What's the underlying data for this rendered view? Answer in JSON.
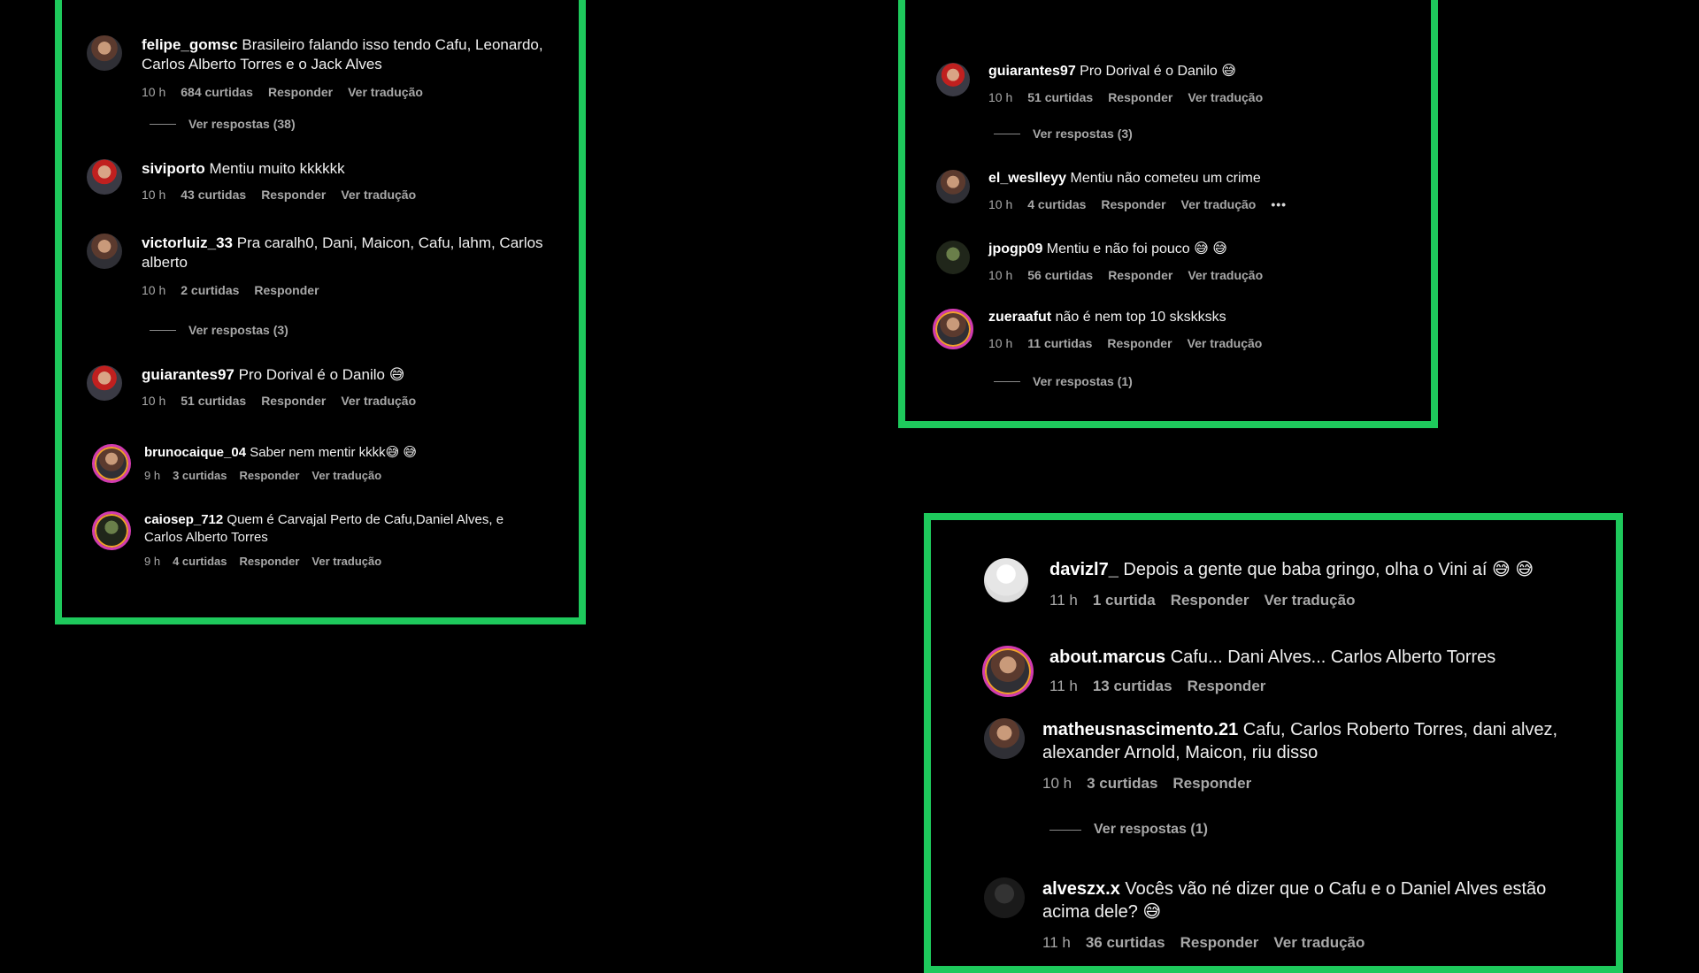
{
  "panel1": {
    "comments": [
      {
        "user": "felipe_gomsc",
        "text": "Brasileiro falando isso tendo Cafu, Leonardo,",
        "text2": "Carlos Alberto Torres e o Jack Alves",
        "time": "10 h",
        "likes": "684 curtidas",
        "reply": "Responder",
        "translate": "Ver tradução"
      },
      {
        "user": "siviporto",
        "text": "Mentiu muito kkkkkk",
        "time": "10 h",
        "likes": "43 curtidas",
        "reply": "Responder",
        "translate": "Ver tradução"
      },
      {
        "user": "victorluiz_33",
        "text": "Pra caralh0, Dani, Maicon, Cafu, lahm, Carlos",
        "text2": "alberto",
        "time": "10 h",
        "likes": "2 curtidas",
        "reply": "Responder"
      },
      {
        "user": "guiarantes97",
        "text": "Pro Dorival é o Danilo 😅",
        "time": "10 h",
        "likes": "51 curtidas",
        "reply": "Responder",
        "translate": "Ver tradução"
      },
      {
        "user": "brunocaique_04",
        "text": "Saber nem mentir kkkk😅 😅",
        "time": "9 h",
        "likes": "3 curtidas",
        "reply": "Responder",
        "translate": "Ver tradução"
      },
      {
        "user": "caiosep_712",
        "text": "Quem é Carvajal Perto de Cafu,Daniel Alves, e",
        "text2": "Carlos Alberto Torres",
        "time": "9 h",
        "likes": "4 curtidas",
        "reply": "Responder",
        "translate": "Ver tradução"
      }
    ],
    "replies": [
      "Ver respostas (38)",
      "Ver respostas (3)"
    ]
  },
  "panel2": {
    "comments": [
      {
        "user": "guiarantes97",
        "text": "Pro Dorival é o Danilo 😅",
        "time": "10 h",
        "likes": "51 curtidas",
        "reply": "Responder",
        "translate": "Ver tradução"
      },
      {
        "user": "el_weslleyy",
        "text": "Mentiu não cometeu um crime",
        "time": "10 h",
        "likes": "4 curtidas",
        "reply": "Responder",
        "translate": "Ver tradução",
        "more": "•••"
      },
      {
        "user": "jpogp09",
        "text": "Mentiu e não foi pouco 😅 😅",
        "time": "10 h",
        "likes": "56 curtidas",
        "reply": "Responder",
        "translate": "Ver tradução"
      },
      {
        "user": "zueraafut",
        "text": "não é nem top 10 skskksks",
        "time": "10 h",
        "likes": "11 curtidas",
        "reply": "Responder",
        "translate": "Ver tradução"
      }
    ],
    "replies": [
      "Ver respostas (3)",
      "Ver respostas (1)"
    ]
  },
  "panel3": {
    "comments": [
      {
        "user": "davizl7_",
        "text": "Depois a gente que baba gringo, olha o Vini aí 😅 😅",
        "time": "11 h",
        "likes": "1 curtida",
        "reply": "Responder",
        "translate": "Ver tradução"
      },
      {
        "user": "about.marcus",
        "text": "Cafu... Dani Alves... Carlos Alberto Torres",
        "time": "11 h",
        "likes": "13 curtidas",
        "reply": "Responder"
      },
      {
        "user": "matheusnascimento.21",
        "text": "Cafu, Carlos Roberto Torres, dani alvez,",
        "text2": "alexander Arnold, Maicon, riu disso",
        "time": "10 h",
        "likes": "3 curtidas",
        "reply": "Responder"
      },
      {
        "user": "alveszx.x",
        "text": "Vocês vão né dizer que o Cafu e o Daniel Alves estão",
        "text2": "acima dele? 😅",
        "time": "11 h",
        "likes": "36 curtidas",
        "reply": "Responder",
        "translate": "Ver tradução"
      }
    ],
    "replies": [
      "Ver respostas (1)"
    ]
  },
  "colors": {
    "frame": "#1ec95c",
    "background": "#000000",
    "meta": "#a8a8a8"
  }
}
